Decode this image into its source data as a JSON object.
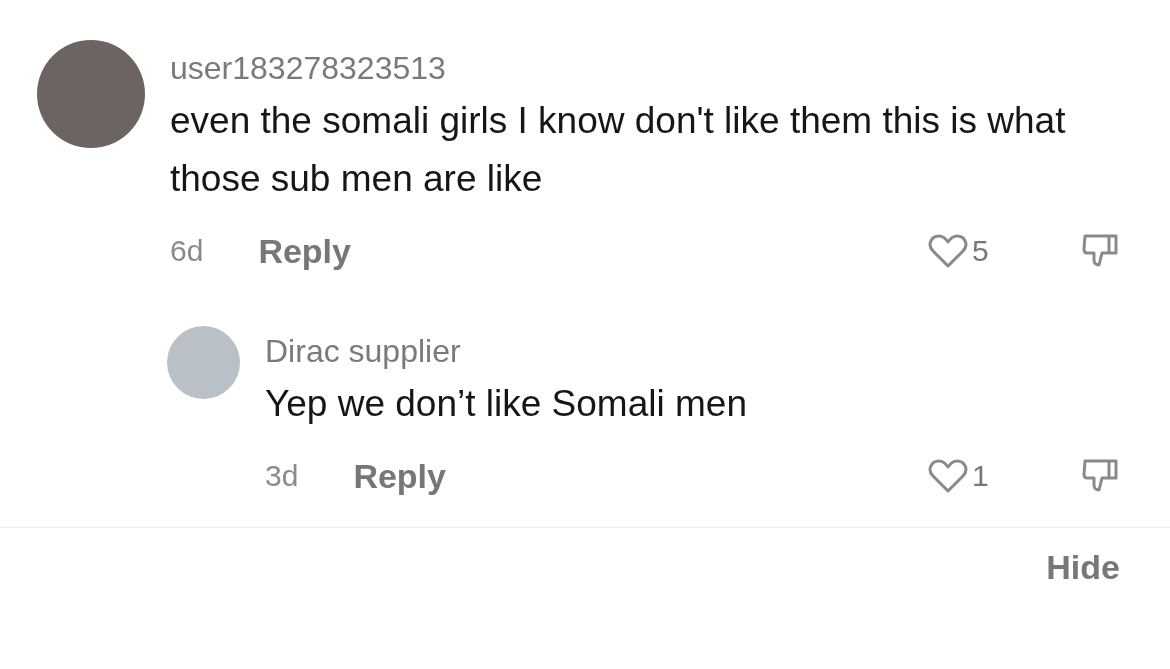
{
  "comments": [
    {
      "username": "user183278323513",
      "text": "even the somali girls I know don't like them this is what those sub men are like",
      "age": "6d",
      "reply_label": "Reply",
      "likes": "5",
      "replies": [
        {
          "username": "Dirac supplier",
          "text": "Yep we don’t like Somali men",
          "age": "3d",
          "reply_label": "Reply",
          "likes": "1"
        }
      ]
    }
  ],
  "hide_label": "Hide"
}
